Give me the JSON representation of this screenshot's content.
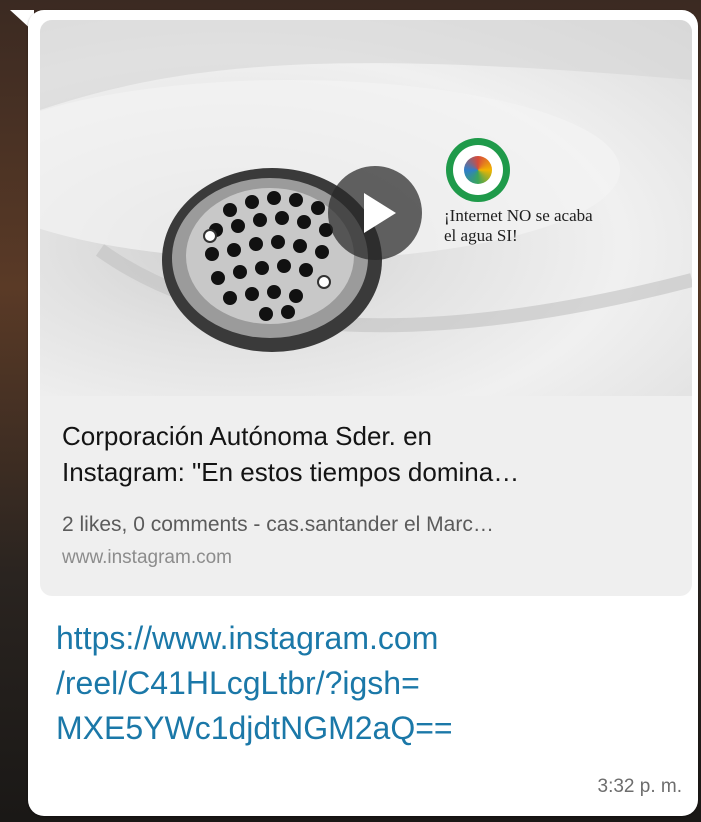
{
  "message": {
    "preview": {
      "overlay_text_line1": "¡Internet NO se acaba",
      "overlay_text_line2": "el agua SI!",
      "title_line1": "Corporación Autónoma Sder. en",
      "title_line2": "Instagram: \"En estos tiempos domina…",
      "description": "2 likes, 0 comments - cas.santander el Marc…",
      "domain": "www.instagram.com",
      "play_icon": "play-icon"
    },
    "link_lines": [
      "https://www.instagram.com",
      "/reel/C41HLcgLtbr/?igsh=",
      "MXE5YWc1djdtNGM2aQ=="
    ],
    "time": "3:32 p. m."
  },
  "colors": {
    "bubble": "#ffffff",
    "preview_card": "#efefef",
    "link": "#1b78a8",
    "logo_ring": "#1f9a4a"
  }
}
